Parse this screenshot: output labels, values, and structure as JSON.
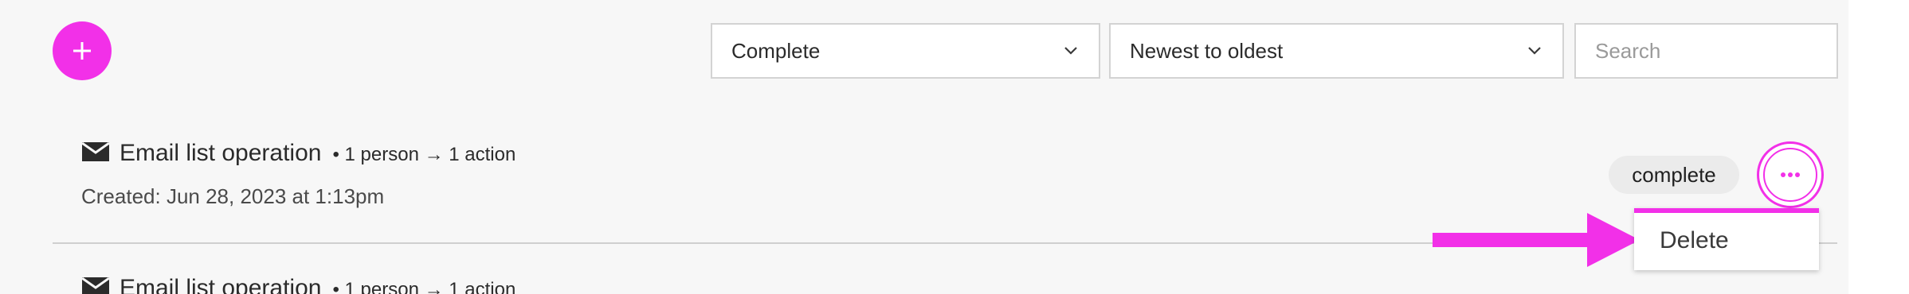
{
  "toolbar": {
    "add_icon": "plus-icon",
    "status_filter": {
      "value": "Complete",
      "icon": "chevron-down-icon"
    },
    "sort_filter": {
      "value": "Newest to oldest",
      "icon": "chevron-down-icon"
    },
    "search": {
      "placeholder": "Search",
      "value": ""
    }
  },
  "operations": [
    {
      "icon": "mail-icon",
      "title": "Email list operation",
      "meta": "• 1 person → 1 action",
      "created": "Created: Jun 28, 2023 at 1:13pm",
      "status": "complete"
    },
    {
      "icon": "mail-icon",
      "title": "Email list operation",
      "meta": "• 1 person → 1 action"
    }
  ],
  "row_menu": {
    "trigger_icon": "more-horizontal-icon",
    "items": [
      "Delete"
    ]
  },
  "annotation": {
    "icon": "arrow-right-icon",
    "color": "#f230e8"
  },
  "colors": {
    "accent": "#f230e8",
    "border": "#d3d3d3",
    "badge_bg": "#ebebeb",
    "background": "#f7f7f7"
  }
}
